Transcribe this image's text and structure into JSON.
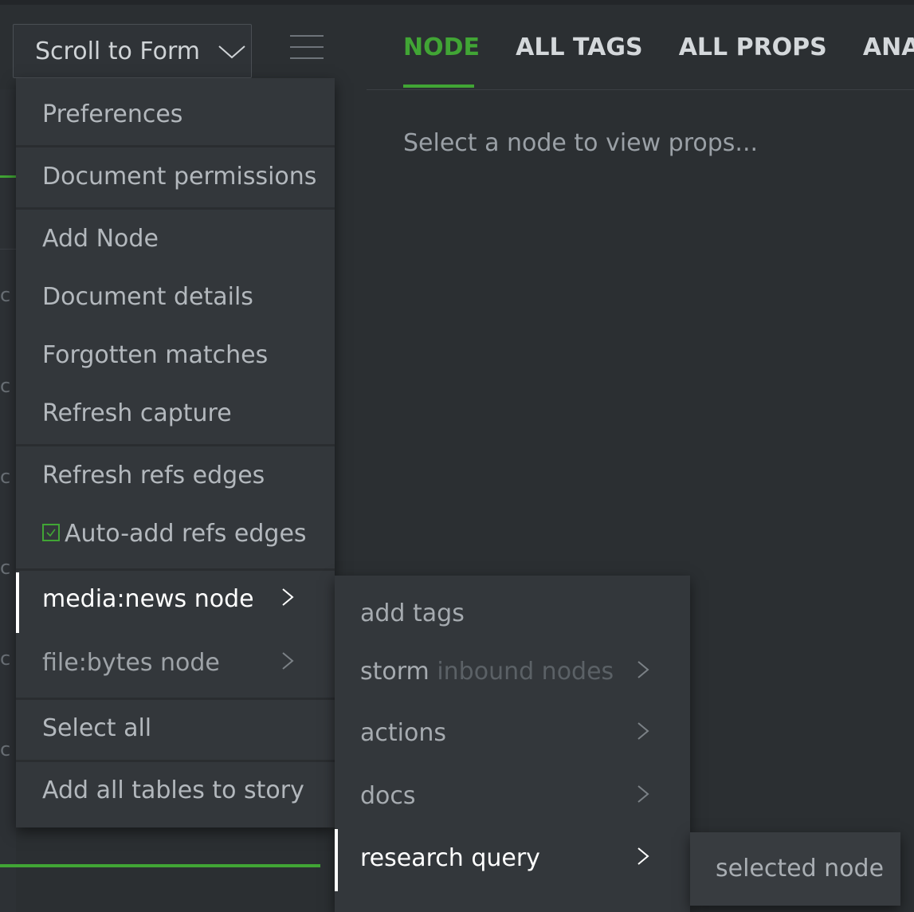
{
  "toolbar": {
    "scroll_label": "Scroll to Form"
  },
  "tabs": [
    {
      "label": "NODE",
      "active": true
    },
    {
      "label": "ALL TAGS",
      "active": false
    },
    {
      "label": "ALL PROPS",
      "active": false
    },
    {
      "label": "ANATO",
      "active": false
    }
  ],
  "props_panel": {
    "empty_message": "Select a node to view props..."
  },
  "menu": {
    "items": [
      {
        "label": "Preferences"
      },
      {
        "label": "Document permissions"
      },
      {
        "label": "Add Node"
      },
      {
        "label": "Document details"
      },
      {
        "label": "Forgotten matches"
      },
      {
        "label": "Refresh capture"
      },
      {
        "label": "Refresh refs edges"
      },
      {
        "label": "Auto-add refs edges",
        "checked": true
      },
      {
        "label": "media:news node",
        "has_submenu": true,
        "active": true
      },
      {
        "label": "file:bytes node",
        "has_submenu": true
      },
      {
        "label": "Select all"
      },
      {
        "label": "Add all tables to story"
      }
    ]
  },
  "submenu": {
    "items": [
      {
        "label": "add tags"
      },
      {
        "label": "storm",
        "suffix": "inbound nodes",
        "has_submenu": true
      },
      {
        "label": "actions",
        "has_submenu": true
      },
      {
        "label": "docs",
        "has_submenu": true
      },
      {
        "label": "research query",
        "has_submenu": true,
        "active": true
      }
    ]
  },
  "submenu2": {
    "items": [
      {
        "label": "selected node"
      }
    ]
  },
  "colors": {
    "accent": "#41a535",
    "background": "#2b2f32",
    "menu_bg": "#33373b"
  },
  "icons": {
    "dropdown": "chevron-down-icon",
    "menu": "hamburger-menu-icon",
    "submenu": "chevron-right-icon",
    "check": "checkbox-checked-icon"
  }
}
